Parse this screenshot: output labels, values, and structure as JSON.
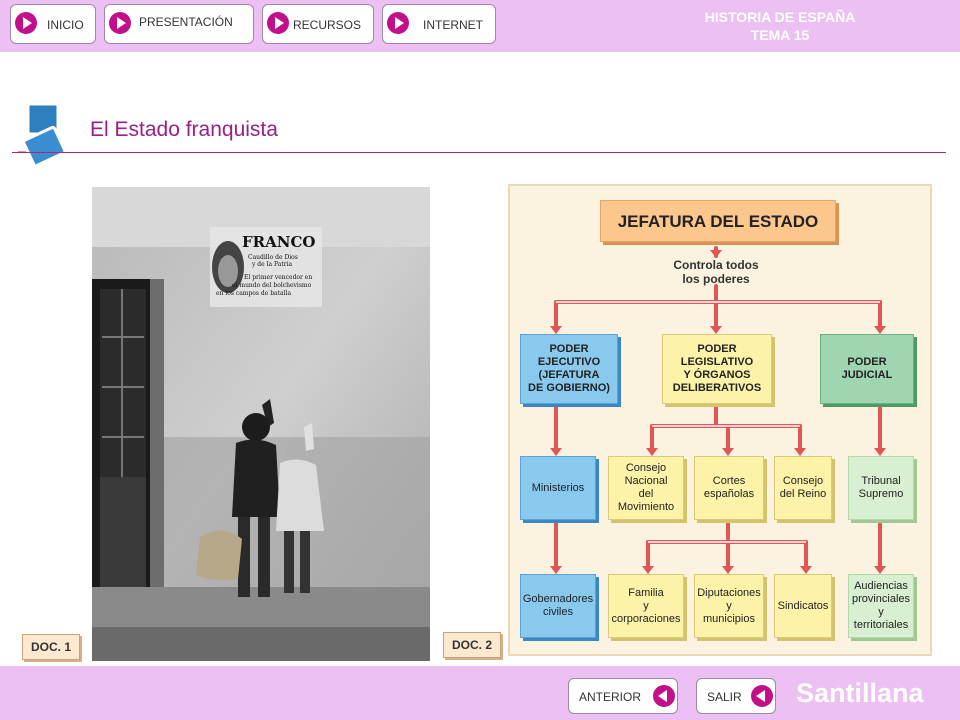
{
  "header": {
    "title_line1": "HISTORIA DE ESPAÑA",
    "title_line2": "TEMA 15",
    "nav": [
      {
        "label": "INICIO"
      },
      {
        "label": "PRESENTACIÓN"
      },
      {
        "label": "RECURSOS"
      },
      {
        "label": "INTERNET"
      }
    ]
  },
  "page": {
    "title": "El Estado franquista"
  },
  "photo": {
    "poster_line1": "FRANCO",
    "poster_line2": "Caudillo de Dios\ny de la Patria",
    "poster_line3": "El primer vencedor en\nel mundo del bolchevismo\nen los campos de batalla"
  },
  "docs": {
    "doc1": "DOC. 1",
    "doc2": "DOC. 2"
  },
  "diagram": {
    "top": "JEFATURA DEL ESTADO",
    "note": "Controla todos\nlos poderes",
    "ejecutivo": "PODER\nEJECUTIVO\n(JEFATURA\nDE GOBIERNO)",
    "legislativo": "PODER\nLEGISLATIVO\nY ÓRGANOS\nDELIBERATIVOS",
    "judicial": "PODER\nJUDICIAL",
    "ministerios": "Ministerios",
    "consejo_nacional": "Consejo\nNacional\ndel\nMovimiento",
    "cortes": "Cortes\nespañolas",
    "consejo_reino": "Consejo\ndel Reino",
    "tribunal": "Tribunal\nSupremo",
    "gobernadores": "Gobernadores\nciviles",
    "familia": "Familia\ny\ncorporaciones",
    "diputaciones": "Diputaciones\ny\nmunicipios",
    "sindicatos": "Sindicatos",
    "audiencias": "Audiencias\nprovinciales\ny\nterritoriales"
  },
  "footer": {
    "prev": "ANTERIOR",
    "exit": "SALIR",
    "brand": "Santillana"
  },
  "colors": {
    "bar": "#ecc0f2",
    "accent": "#c2108a",
    "title": "#9c1f87",
    "connector": "#e05656"
  }
}
